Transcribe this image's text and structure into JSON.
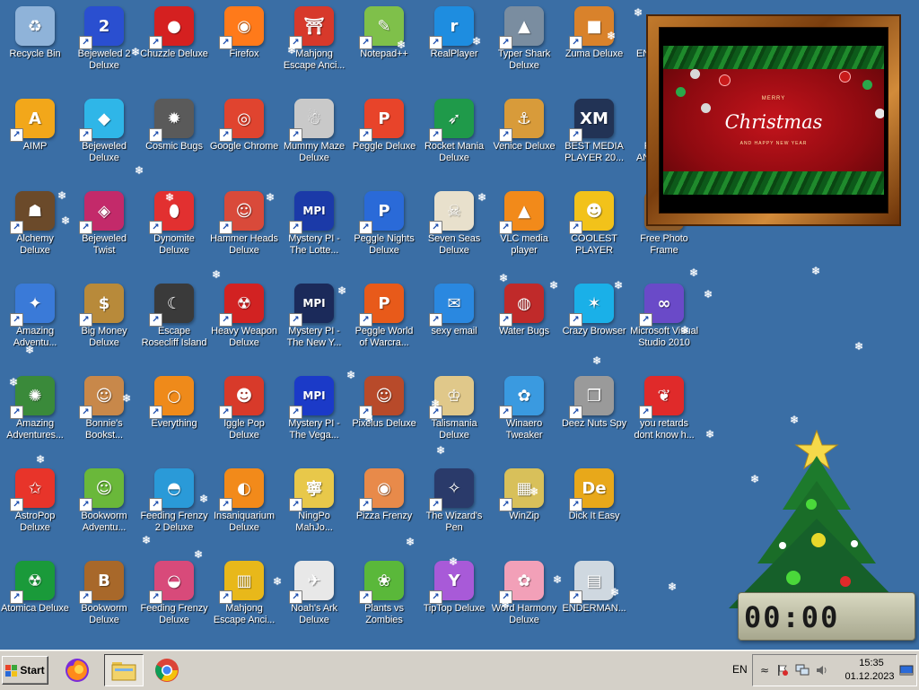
{
  "desktop": {
    "icons": [
      {
        "label": "Recycle Bin",
        "icon": "recycle-bin-icon",
        "color": "#8fb3d9",
        "glyph": "♻",
        "shortcut": false
      },
      {
        "label": "Bejeweled 2\nDeluxe",
        "icon": "bejeweled-2-icon",
        "color": "#2a4fd0",
        "glyph": "2",
        "shortcut": true
      },
      {
        "label": "Chuzzle Deluxe",
        "icon": "chuzzle-icon",
        "color": "#d52020",
        "glyph": "●",
        "shortcut": true
      },
      {
        "label": "Firefox",
        "icon": "firefox-icon",
        "color": "#ff7a1a",
        "glyph": "◉",
        "shortcut": true
      },
      {
        "label": "Mahjong\nEscape Anci...",
        "icon": "mahjong-gate-icon",
        "color": "#d7392b",
        "glyph": "⛩",
        "shortcut": true
      },
      {
        "label": "Notepad++",
        "icon": "notepad-plus-plus-icon",
        "color": "#7fc04a",
        "glyph": "✎",
        "shortcut": true
      },
      {
        "label": "RealPlayer",
        "icon": "realplayer-icon",
        "color": "#1e8de0",
        "glyph": "r",
        "shortcut": true
      },
      {
        "label": "Typer Shark\nDeluxe",
        "icon": "typer-shark-icon",
        "color": "#7a8da0",
        "glyph": "▲",
        "shortcut": true
      },
      {
        "label": "Zuma Deluxe",
        "icon": "zuma-icon",
        "color": "#d9822b",
        "glyph": "■",
        "shortcut": true
      },
      {
        "label": "AIMP",
        "icon": "aimp-icon",
        "color": "#f2a71a",
        "glyph": "A",
        "shortcut": true
      },
      {
        "label": "Bejeweled\nDeluxe",
        "icon": "bejeweled-icon",
        "color": "#2fb6e8",
        "glyph": "◆",
        "shortcut": true
      },
      {
        "label": "Cosmic Bugs",
        "icon": "cosmic-bugs-icon",
        "color": "#5a5a5a",
        "glyph": "✹",
        "shortcut": true
      },
      {
        "label": "Google Chrome",
        "icon": "chrome-icon",
        "color": "#e0442f",
        "glyph": "◎",
        "shortcut": true
      },
      {
        "label": "Mummy Maze\nDeluxe",
        "icon": "mummy-maze-icon",
        "color": "#c9c9c9",
        "glyph": "☃",
        "shortcut": true
      },
      {
        "label": "Peggle Deluxe",
        "icon": "peggle-icon",
        "color": "#e8442a",
        "glyph": "P",
        "shortcut": true
      },
      {
        "label": "Rocket Mania\nDeluxe",
        "icon": "rocket-mania-icon",
        "color": "#1f9a4a",
        "glyph": "➶",
        "shortcut": true
      },
      {
        "label": "Venice Deluxe",
        "icon": "venice-icon",
        "color": "#d89b3a",
        "glyph": "⚓",
        "shortcut": true
      },
      {
        "label": "BEST MEDIA\nPLAYER 20...",
        "icon": "xm-play-icon",
        "color": "#223355",
        "glyph": "XM",
        "shortcut": true
      },
      {
        "label": "Alchemy\nDeluxe",
        "icon": "alchemy-icon",
        "color": "#6b4a2a",
        "glyph": "☗",
        "shortcut": true
      },
      {
        "label": "Bejeweled\nTwist",
        "icon": "bejeweled-twist-icon",
        "color": "#c32a6a",
        "glyph": "◈",
        "shortcut": true
      },
      {
        "label": "Dynomite\nDeluxe",
        "icon": "dynomite-icon",
        "color": "#e23030",
        "glyph": "⬮",
        "shortcut": true
      },
      {
        "label": "Hammer Heads\nDeluxe",
        "icon": "hammer-heads-icon",
        "color": "#d94a3a",
        "glyph": "☺",
        "shortcut": true
      },
      {
        "label": "Mystery PI -\nThe Lotte...",
        "icon": "mystery-pi-lottery-icon",
        "color": "#1b3aa8",
        "glyph": "MPI",
        "shortcut": true
      },
      {
        "label": "Peggle Nights\nDeluxe",
        "icon": "peggle-nights-icon",
        "color": "#2a6ad8",
        "glyph": "P",
        "shortcut": true
      },
      {
        "label": "Seven Seas\nDeluxe",
        "icon": "seven-seas-icon",
        "color": "#e8e0cc",
        "glyph": "☠",
        "shortcut": true
      },
      {
        "label": "VLC media\nplayer",
        "icon": "vlc-icon",
        "color": "#f28a1a",
        "glyph": "▲",
        "shortcut": true
      },
      {
        "label": "COOLEST\nPLAYER",
        "icon": "coolest-player-icon",
        "color": "#f2c21a",
        "glyph": "☻",
        "shortcut": true
      },
      {
        "label": "Free Photo\nFrame",
        "icon": "free-photo-frame-icon",
        "color": "#8a5a2a",
        "glyph": "▣",
        "shortcut": false
      },
      {
        "label": "Amazing\nAdventu...",
        "icon": "amazing-adventures-icon",
        "color": "#3a7ad8",
        "glyph": "✦",
        "shortcut": true
      },
      {
        "label": "Big Money\nDeluxe",
        "icon": "big-money-icon",
        "color": "#b88a3a",
        "glyph": "$",
        "shortcut": true
      },
      {
        "label": "Escape\nRosecliff Island",
        "icon": "escape-rosecliff-icon",
        "color": "#3a3a3a",
        "glyph": "☾",
        "shortcut": true
      },
      {
        "label": "Heavy Weapon\nDeluxe",
        "icon": "heavy-weapon-icon",
        "color": "#d22222",
        "glyph": "☢",
        "shortcut": true
      },
      {
        "label": "Mystery PI -\nThe New Y...",
        "icon": "mystery-pi-new-york-icon",
        "color": "#1b2a5a",
        "glyph": "MPI",
        "shortcut": true
      },
      {
        "label": "Peggle World\nof Warcra...",
        "icon": "peggle-warcraft-icon",
        "color": "#e85a1a",
        "glyph": "P",
        "shortcut": true
      },
      {
        "label": "sexy email",
        "icon": "email-icon",
        "color": "#2a88e0",
        "glyph": "✉",
        "shortcut": true
      },
      {
        "label": "Water Bugs",
        "icon": "water-bugs-icon",
        "color": "#c02a2a",
        "glyph": "◍",
        "shortcut": true
      },
      {
        "label": "Crazy Browser",
        "icon": "crazy-browser-icon",
        "color": "#1ab0e8",
        "glyph": "✶",
        "shortcut": true
      },
      {
        "label": "Microsoft Visual\nStudio 2010",
        "icon": "visual-studio-icon",
        "color": "#6a4ac8",
        "glyph": "∞",
        "shortcut": true
      },
      {
        "label": "Amazing\nAdventures...",
        "icon": "amazing-adventures-2-icon",
        "color": "#3a8a3a",
        "glyph": "✺",
        "shortcut": true
      },
      {
        "label": "Bonnie's\nBookst...",
        "icon": "bonnies-bookstore-icon",
        "color": "#c8884a",
        "glyph": "☺",
        "shortcut": true
      },
      {
        "label": "Everything",
        "icon": "everything-search-icon",
        "color": "#ef8a1a",
        "glyph": "○",
        "shortcut": true
      },
      {
        "label": "Iggle Pop\nDeluxe",
        "icon": "iggle-pop-icon",
        "color": "#d83a2a",
        "glyph": "☻",
        "shortcut": true
      },
      {
        "label": "Mystery PI -\nThe Vega...",
        "icon": "mystery-pi-vegas-icon",
        "color": "#1b3ac8",
        "glyph": "MPI",
        "shortcut": true
      },
      {
        "label": "Pixelus Deluxe",
        "icon": "pixelus-icon",
        "color": "#b84a2a",
        "glyph": "☺",
        "shortcut": true
      },
      {
        "label": "Talismania\nDeluxe",
        "icon": "talismania-icon",
        "color": "#e0c88a",
        "glyph": "♔",
        "shortcut": true
      },
      {
        "label": "Winaero\nTweaker",
        "icon": "winaero-tweaker-icon",
        "color": "#3a9ae0",
        "glyph": "✿",
        "shortcut": true
      },
      {
        "label": "Deez Nuts Spy",
        "icon": "deez-nuts-spy-icon",
        "color": "#9a9a9a",
        "glyph": "❐",
        "shortcut": true
      },
      {
        "label": "you retards\ndont know h...",
        "icon": "red-bird-icon",
        "color": "#e02a2a",
        "glyph": "❦",
        "shortcut": true
      },
      {
        "label": "AstroPop\nDeluxe",
        "icon": "astropop-icon",
        "color": "#e8342a",
        "glyph": "✩",
        "shortcut": true
      },
      {
        "label": "Bookworm\nAdventu...",
        "icon": "bookworm-adventures-icon",
        "color": "#6ab83a",
        "glyph": "☺",
        "shortcut": true
      },
      {
        "label": "Feeding Frenzy\n2 Deluxe",
        "icon": "feeding-frenzy-2-icon",
        "color": "#2a9ad8",
        "glyph": "◓",
        "shortcut": true
      },
      {
        "label": "Insaniquarium\nDeluxe",
        "icon": "insaniquarium-icon",
        "color": "#f28a1a",
        "glyph": "◐",
        "shortcut": true
      },
      {
        "label": "NingPo\nMahJo...",
        "icon": "ningpo-mahjong-icon",
        "color": "#e8c84a",
        "glyph": "寧",
        "shortcut": true
      },
      {
        "label": "Pizza Frenzy",
        "icon": "pizza-frenzy-icon",
        "color": "#e88a4a",
        "glyph": "◉",
        "shortcut": true
      },
      {
        "label": "The Wizard's\nPen",
        "icon": "wizards-pen-icon",
        "color": "#2a3a6a",
        "glyph": "✧",
        "shortcut": true
      },
      {
        "label": "WinZip",
        "icon": "winzip-icon",
        "color": "#d8c05a",
        "glyph": "▦",
        "shortcut": true
      },
      {
        "label": "Dick It Easy",
        "icon": "de-letters-icon",
        "color": "#e8a81a",
        "glyph": "De",
        "shortcut": true
      },
      {
        "label": "Atomica Deluxe",
        "icon": "atomica-icon",
        "color": "#1a9a3a",
        "glyph": "☢",
        "shortcut": true
      },
      {
        "label": "Bookworm\nDeluxe",
        "icon": "bookworm-icon",
        "color": "#a8682a",
        "glyph": "B",
        "shortcut": true
      },
      {
        "label": "Feeding Frenzy\nDeluxe",
        "icon": "feeding-frenzy-icon",
        "color": "#d84a7a",
        "glyph": "◒",
        "shortcut": true
      },
      {
        "label": "Mahjong\nEscape Anci...",
        "icon": "mahjong-tile-icon",
        "color": "#e8b81a",
        "glyph": "▥",
        "shortcut": true
      },
      {
        "label": "Noah's Ark\nDeluxe",
        "icon": "noahs-ark-dove-icon",
        "color": "#e8e8e8",
        "glyph": "✈",
        "shortcut": true
      },
      {
        "label": "Plants vs\nZombies",
        "icon": "plants-vs-zombies-icon",
        "color": "#5ab83a",
        "glyph": "❀",
        "shortcut": true
      },
      {
        "label": "TipTop Deluxe",
        "icon": "tiptop-icon",
        "color": "#a85ad8",
        "glyph": "Y",
        "shortcut": true
      },
      {
        "label": "Word Harmony\nDeluxe",
        "icon": "word-harmony-icon",
        "color": "#f2a0b8",
        "glyph": "✿",
        "shortcut": true
      },
      {
        "label": "ENDERMAN...",
        "icon": "enderman-window-icon",
        "color": "#cfd8e0",
        "glyph": "▤",
        "shortcut": true
      },
      {
        "label": "EN...",
        "icon": "partially-hidden-icon",
        "color": "#3a6ea5",
        "glyph": "",
        "shortcut": false
      },
      {
        "label": "F\nAN...",
        "icon": "partially-hidden-icon-2",
        "color": "#3a6ea5",
        "glyph": "",
        "shortcut": false
      }
    ]
  },
  "photo_frame": {
    "title": "Christmas",
    "merry": "MERRY",
    "subtitle": "AND HAPPY NEW YEAR"
  },
  "clock_widget": {
    "digits": "00:00"
  },
  "taskbar": {
    "start_label": "Start",
    "pinned": [
      {
        "name": "firefox-taskbar-button",
        "icon": "firefox-icon"
      },
      {
        "name": "explorer-taskbar-button",
        "icon": "folder-icon"
      },
      {
        "name": "chrome-taskbar-button",
        "icon": "chrome-icon"
      }
    ],
    "language": "EN",
    "time": "15:35",
    "date": "01.12.2023"
  },
  "colors": {
    "desktop_bg": "#3a6ea5",
    "taskbar_bg": "#d4d0c8",
    "start_logo": [
      "#e8452a",
      "#3aa63a",
      "#2a6ad8",
      "#f2c21a"
    ]
  }
}
